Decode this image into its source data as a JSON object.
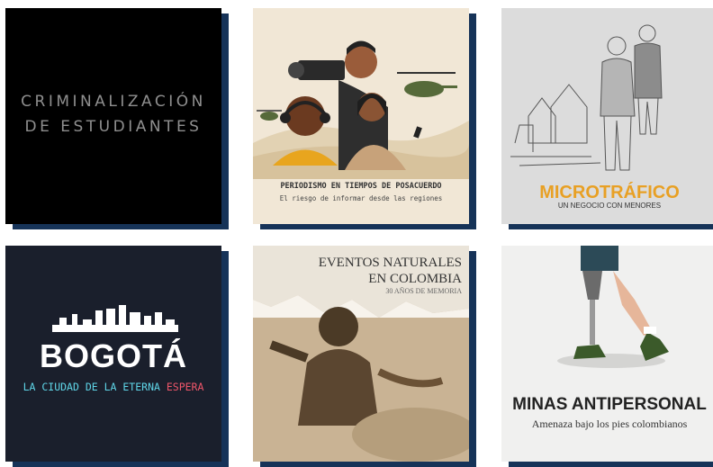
{
  "cards": [
    {
      "line1": "CRIMINALIZACIÓN",
      "line2": "DE ESTUDIANTES"
    },
    {
      "title": "PERIODISMO EN TIEMPOS DE POSACUERDO",
      "subtitle": "El riesgo de informar desde las regiones"
    },
    {
      "title": "MICROTRÁFICO",
      "subtitle": "UN NEGOCIO CON MENORES"
    },
    {
      "title": "BOGOTÁ",
      "subtitle_main": "LA CIUDAD DE LA ETERNA ",
      "subtitle_accent": "ESPERA"
    },
    {
      "line1": "EVENTOS NATURALES",
      "line2": "EN COLOMBIA",
      "subtitle": "30 AÑOS DE MEMORIA"
    },
    {
      "title": "MINAS ANTIPERSONAL",
      "subtitle": "Amenaza bajo los pies colombianos"
    }
  ],
  "colors": {
    "shadow": "#163358",
    "microtrafico": "#e8a024",
    "neon_cyan": "#5fd6e8",
    "neon_red": "#f0566a"
  }
}
